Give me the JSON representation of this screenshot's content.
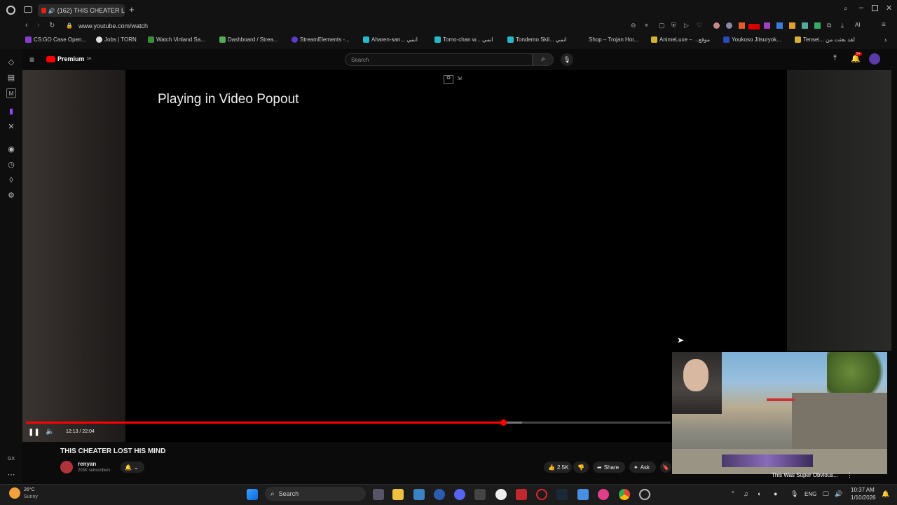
{
  "browser": {
    "tab_title": "(162) THIS CHEATER L",
    "url": "www.youtube.com/watch",
    "bookmarks": [
      "CS:GO Case Open...",
      "Jobs | TORN",
      "Watch Vinland Sa...",
      "Dashboard / Strea...",
      "StreamElements -...",
      "Aharen-san... انمي",
      "Tomo-chan w... انمي",
      "Tondemo Skil... انمي",
      "Shop – Trojan Hor...",
      "AnimeLuxe – ...موقع",
      "Youkoso Jitsuryok...",
      "Tensei... لقد بعثت من"
    ],
    "toolbar_ai_label": "AI"
  },
  "youtube": {
    "logo_text": "Premium",
    "logo_sup": "SA",
    "search_placeholder": "Search",
    "notifications_badge": "9+",
    "popout_message": "Playing in Video Popout",
    "time_display": "12:13 / 22:04",
    "progress_fraction": 0.74,
    "video_title": "THIS CHEATER LOST HIS MIND",
    "channel_name": "renyan",
    "subscribers": "203K subscribers",
    "likes": "2.5K",
    "share_label": "Share",
    "ask_label": "Ask"
  },
  "mini_player": {
    "title": "This Was Super Obvious..."
  },
  "taskbar": {
    "weather_temp": "26°C",
    "weather_desc": "Sunny",
    "search_label": "Search",
    "language": "ENG",
    "time": "10:37 AM",
    "date": "1/10/2026"
  },
  "colors": {
    "accent": "#ff0000",
    "background": "#0b0b0b"
  }
}
